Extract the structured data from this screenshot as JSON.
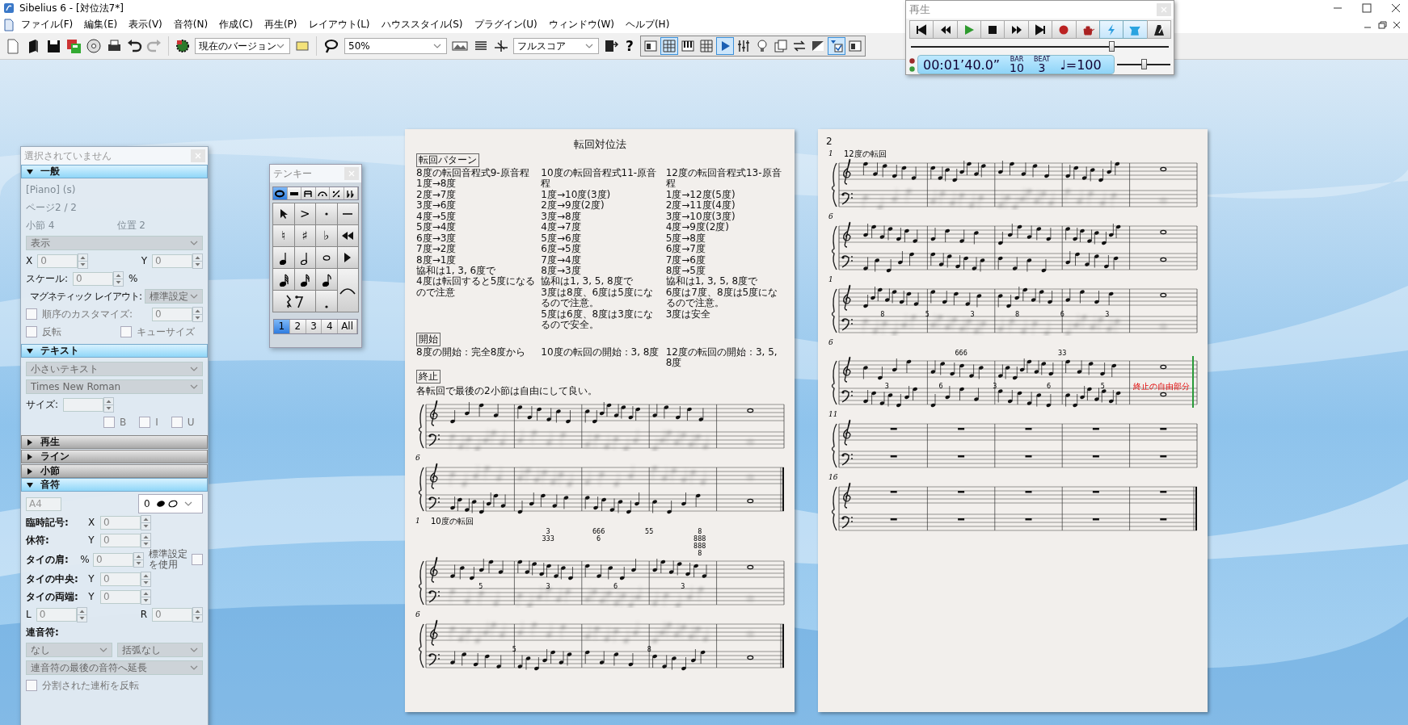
{
  "window": {
    "title": "Sibelius 6 - [対位法7*]"
  },
  "menu": [
    "ファイル(F)",
    "編集(E)",
    "表示(V)",
    "音符(N)",
    "作成(C)",
    "再生(P)",
    "レイアウト(L)",
    "ハウススタイル(S)",
    "プラグイン(U)",
    "ウィンドウ(W)",
    "ヘルプ(H)"
  ],
  "toolbar": {
    "version": "現在のバージョン",
    "zoom": "50%",
    "view": "フルスコア",
    "help": "?",
    "view_toggles": [
      {
        "on": false
      },
      {
        "on": true
      },
      {
        "on": false
      },
      {
        "on": false
      },
      {
        "on": true
      },
      {
        "on": false
      },
      {
        "on": false
      },
      {
        "on": false
      },
      {
        "on": false
      },
      {
        "on": false
      },
      {
        "on": true
      },
      {
        "on": false
      }
    ]
  },
  "playback": {
    "title": "再生",
    "toggles": [
      {
        "on": true
      },
      {
        "on": true
      },
      {
        "on": false
      }
    ],
    "position": {
      "level": 0.78
    },
    "volume": {
      "level": 0.52
    },
    "time": "00:01’40.0”",
    "bar_label": "BAR",
    "bar": "10",
    "beat_label": "BEAT",
    "beat": "3",
    "tempo": "♩=100"
  },
  "properties": {
    "title": "選択されていません",
    "sections": [
      {
        "title": "一般",
        "expanded": true,
        "rows": [
          {
            "kind": "info",
            "texts": [
              "[Piano] (s)"
            ]
          },
          {
            "kind": "info",
            "texts": [
              "ページ2 / 2"
            ]
          },
          {
            "kind": "info",
            "texts": [
              "小節 4",
              "位置 2"
            ]
          },
          {
            "kind": "dropdown",
            "values": [
              "表示"
            ]
          },
          {
            "kind": "spins",
            "items": [
              {
                "label": "X",
                "value": "0"
              },
              {
                "label": "Y",
                "value": "0"
              }
            ]
          },
          {
            "kind": "spins",
            "items": [
              {
                "label": "スケール:",
                "value": "0",
                "unit": "%"
              }
            ]
          },
          {
            "kind": "labeled_dropdown",
            "label": "マグネティック レイアウト:",
            "value": "標準設定"
          },
          {
            "kind": "check_spin",
            "label": "順序のカスタマイズ:",
            "checked": false,
            "value": "0"
          },
          {
            "kind": "checks",
            "items": [
              {
                "label": "反転",
                "checked": false
              },
              {
                "label": "キューサイズ",
                "checked": false
              }
            ]
          }
        ]
      },
      {
        "title": "テキスト",
        "expanded": true,
        "rows": [
          {
            "kind": "dropdown",
            "values": [
              "小さいテキスト"
            ]
          },
          {
            "kind": "dropdown",
            "values": [
              "Times New Roman"
            ]
          },
          {
            "kind": "spins",
            "items": [
              {
                "label": "サイズ:"
              }
            ]
          },
          {
            "kind": "checks",
            "items": [
              {
                "label": "B",
                "checked": false
              },
              {
                "label": "I",
                "checked": false
              },
              {
                "label": "U",
                "checked": false
              }
            ]
          }
        ]
      },
      {
        "title": "再生",
        "expanded": false
      },
      {
        "title": "ライン",
        "expanded": false
      },
      {
        "title": "小節",
        "expanded": false
      },
      {
        "title": "音符",
        "expanded": true,
        "rows": [
          {
            "kind": "notehead",
            "value": "A4",
            "head": "0"
          },
          {
            "kind": "axis_spin",
            "label": "臨時記号:",
            "axis": "X",
            "value": "0"
          },
          {
            "kind": "axis_spin",
            "label": "休符:",
            "axis": "Y",
            "value": "0"
          },
          {
            "kind": "axis_spin",
            "label": "タイの肩:",
            "axis": "%",
            "value": "0",
            "side": {
              "label": "標準設定を使用",
              "checked": false
            }
          },
          {
            "kind": "axis_spin",
            "label": "タイの中央:",
            "axis": "Y",
            "value": "0"
          },
          {
            "kind": "axis_spin",
            "label": "タイの両端:",
            "axis": "Y",
            "value": "0"
          },
          {
            "kind": "spins",
            "items": [
              {
                "label": "L",
                "value": "0"
              },
              {
                "label": "R",
                "value": "0"
              }
            ]
          },
          {
            "kind": "label",
            "text": "連音符:"
          },
          {
            "kind": "dropdown",
            "values": [
              "なし",
              "括弧なし"
            ]
          },
          {
            "kind": "dropdown",
            "values": [
              "連音符の最後の音符へ延長"
            ]
          },
          {
            "kind": "checks",
            "items": [
              {
                "label": "分割された連桁を反転",
                "checked": false
              }
            ]
          }
        ]
      }
    ]
  },
  "keypad": {
    "title": "テンキー",
    "tabs": [
      {
        "selected": true
      },
      {
        "selected": false
      },
      {
        "selected": false
      },
      {
        "selected": false
      },
      {
        "selected": false
      },
      {
        "selected": false
      }
    ],
    "keys": [
      ">",
      "♮",
      "♯",
      "♭"
    ],
    "layouts": [
      {
        "label": "1",
        "selected": true
      },
      {
        "label": "2",
        "selected": false
      },
      {
        "label": "3",
        "selected": false
      },
      {
        "label": "4",
        "selected": false
      },
      {
        "label": "All",
        "selected": false
      }
    ]
  },
  "pages": [
    {
      "title": "転回対位法",
      "pattern_label": "転回パターン",
      "columns": [
        {
          "lines": [
            "8度の転回音程式9-原音程",
            "1度→8度",
            "2度→7度",
            "3度→6度",
            "4度→5度",
            "5度→4度",
            "6度→3度",
            "7度→2度",
            "8度→1度",
            "協和は1, 3, 6度で",
            "4度は転回すると5度になるので注意"
          ]
        },
        {
          "lines": [
            "10度の転回音程式11-原音程",
            "1度→10度(3度)",
            "2度→9度(2度)",
            "3度→8度",
            "4度→7度",
            "5度→6度",
            "6度→5度",
            "7度→4度",
            "8度→3度",
            "協和は1, 3, 5, 8度で",
            "3度は8度、6度は5度になるので注意。",
            "5度は6度、8度は3度になるので安全。"
          ]
        },
        {
          "lines": [
            "12度の転回音程式13-原音程",
            "1度→12度(5度)",
            "2度→11度(4度)",
            "3度→10度(3度)",
            "4度→9度(2度)",
            "5度→8度",
            "6度→7度",
            "7度→6度",
            "8度→5度",
            "協和は1, 3, 5, 8度で",
            "6度は7度、8度は5度になるので注意。",
            "3度は安全"
          ]
        }
      ],
      "start_label": "開始",
      "starts": [
        "8度の開始：完全8度から",
        "10度の転回の開始：3, 8度",
        "12度の転回の開始：3, 5, 8度"
      ],
      "end_label": "終止",
      "end_note": "各転回で最後の2小節は自由にして良い。",
      "systems": [
        {
          "kind": "notes",
          "lower_blurred": true
        },
        {
          "kind": "notes",
          "number": "6",
          "upper_blurred": true,
          "final_barline": true
        },
        {
          "kind": "notes",
          "number": "1",
          "label": "10度の転回",
          "lower_blurred": true,
          "figures_above": [
            {
              "lines": [
                "3",
                "333"
              ]
            },
            {
              "lines": [
                "666",
                "6"
              ]
            },
            {
              "lines": [
                "55"
              ]
            },
            {
              "lines": [
                "8",
                "888",
                "888",
                "8"
              ]
            }
          ],
          "figures_between": [
            "5",
            "3",
            "6",
            "3"
          ]
        },
        {
          "kind": "notes",
          "number": "6",
          "upper_blurred": true,
          "final_barline": true,
          "figures_between": [
            "5",
            "8"
          ]
        }
      ]
    },
    {
      "page_number": "2",
      "systems": [
        {
          "kind": "notes",
          "number": "1",
          "label": "12度の転回",
          "lower_blurred": true
        },
        {
          "kind": "notes",
          "number": "6"
        },
        {
          "kind": "notes",
          "number": "1",
          "lower_blurred": true,
          "figures_between": [
            "8",
            "5",
            "3",
            "8",
            "6",
            "3"
          ]
        },
        {
          "kind": "notes",
          "number": "6",
          "figures_above": [
            {
              "lines": [
                "666"
              ]
            },
            {
              "lines": [
                "33"
              ]
            }
          ],
          "figures_between": [
            "3",
            "6",
            "3",
            "6",
            "5"
          ],
          "annotation": "終止の自由部分",
          "playback_line": true
        },
        {
          "kind": "rests",
          "number": "11"
        },
        {
          "kind": "rests",
          "number": "16",
          "final_barline": true
        }
      ]
    }
  ]
}
